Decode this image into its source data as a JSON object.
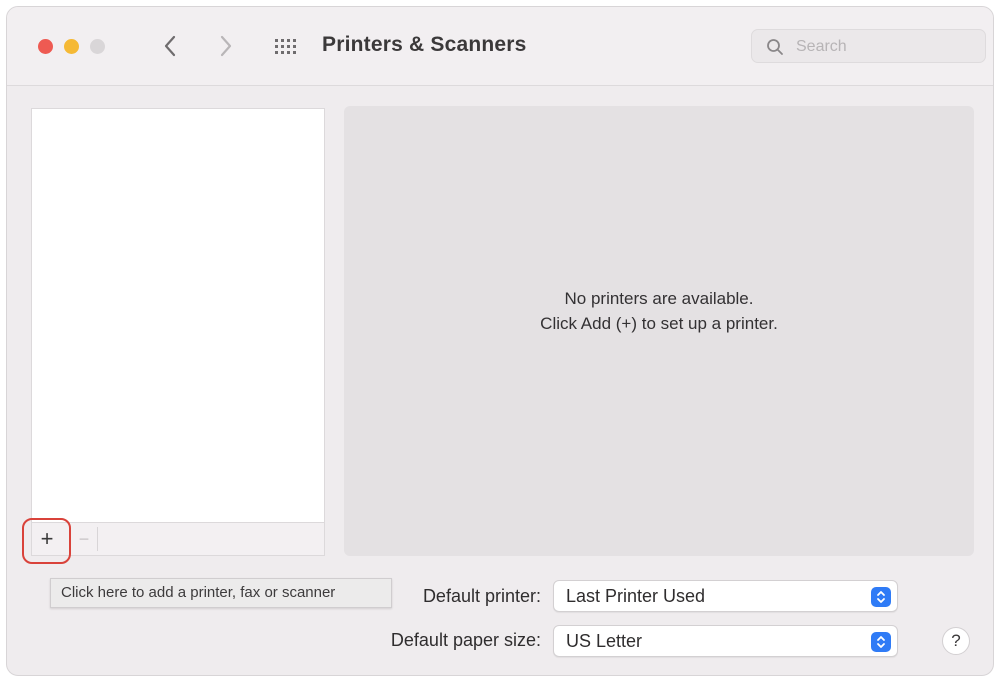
{
  "window": {
    "title": "Printers & Scanners"
  },
  "search": {
    "placeholder": "Search"
  },
  "detail": {
    "empty_line1": "No printers are available.",
    "empty_line2": "Click Add (+) to set up a printer."
  },
  "list_toolbar": {
    "add_label": "+",
    "remove_label": "−"
  },
  "tooltip": {
    "text": "Click here to add a printer, fax or scanner"
  },
  "settings": {
    "default_printer_label": "Default printer:",
    "default_printer_value": "Last Printer Used",
    "paper_size_label": "Default paper size:",
    "paper_size_value": "US Letter"
  },
  "help": {
    "label": "?"
  },
  "icons": {
    "back": "chevron-left-icon",
    "forward": "chevron-right-icon",
    "all_prefs": "grid-icon",
    "search": "search-icon",
    "popup": "up-down-chevron-icon"
  },
  "colors": {
    "accent": "#2f7bf6",
    "close": "#ee5a52",
    "minimize": "#f5b935",
    "zoom_disabled": "#d9d6d8",
    "highlight_ring": "#d9423a"
  }
}
